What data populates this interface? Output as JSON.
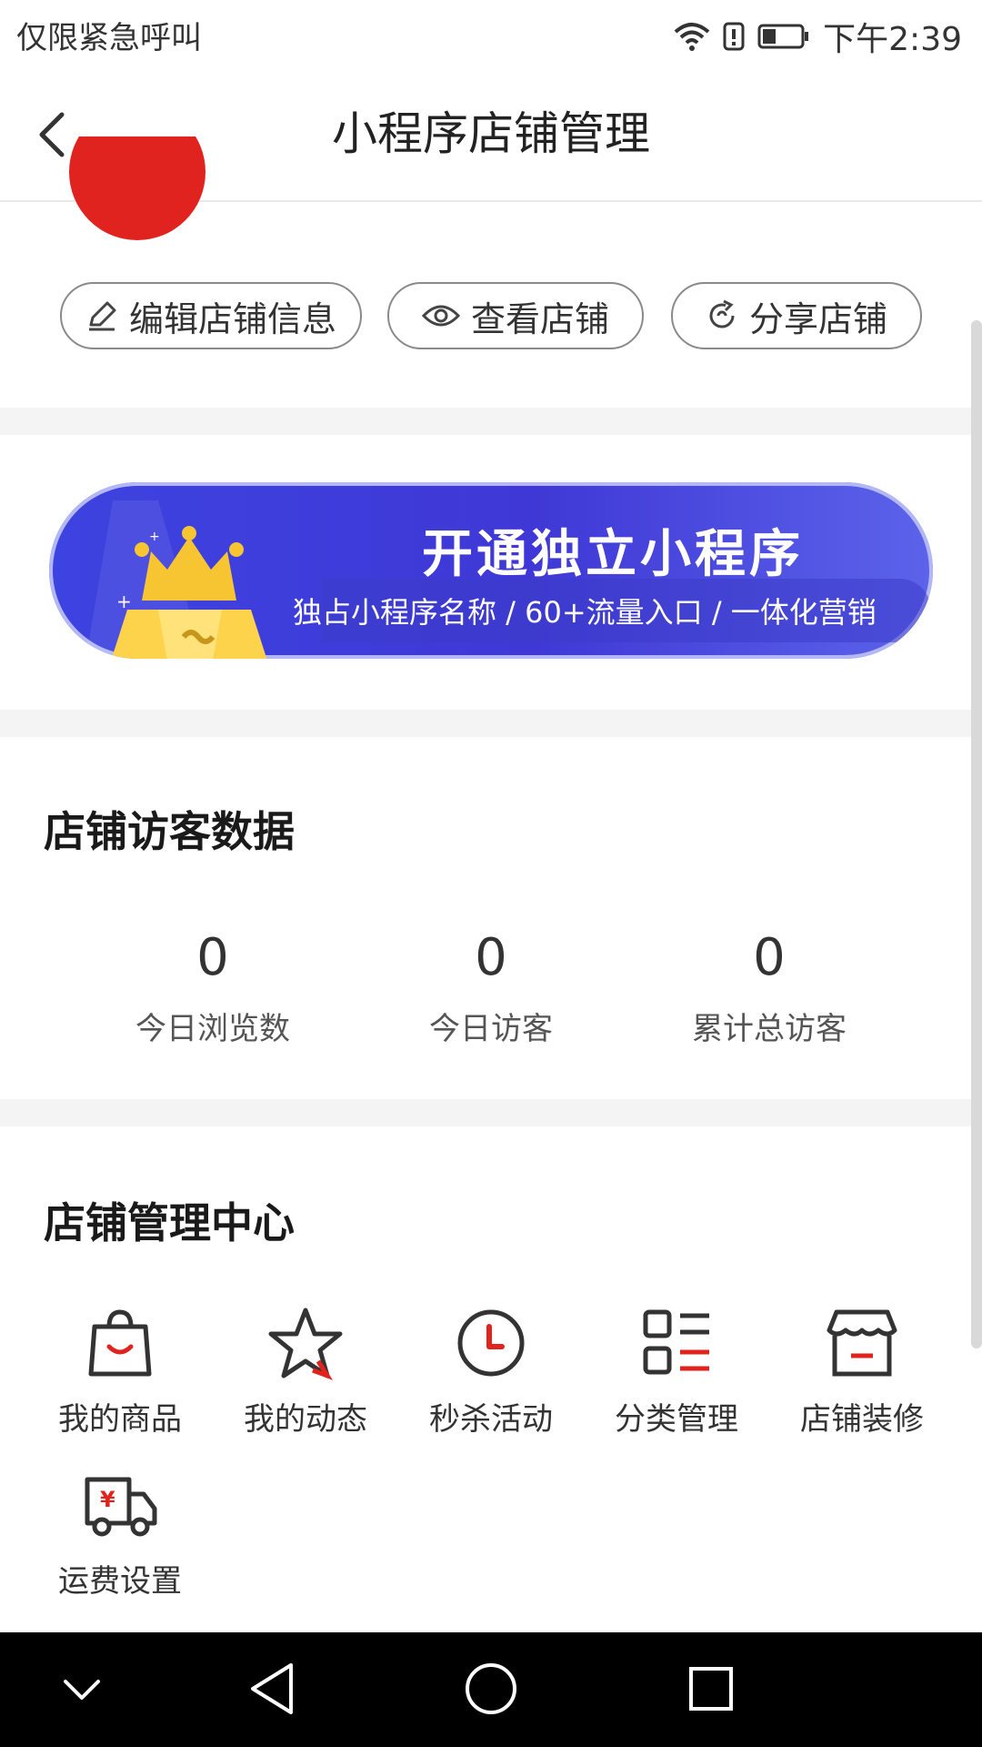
{
  "status_bar": {
    "carrier_text": "仅限紧急呼叫",
    "time": "下午2:39",
    "icons": [
      "wifi-icon",
      "alert-icon",
      "battery-icon"
    ]
  },
  "nav": {
    "title": "小程序店铺管理",
    "back_icon": "chevron-left-icon"
  },
  "actions": [
    {
      "label": "编辑店铺信息",
      "icon": "edit-icon"
    },
    {
      "label": "查看店铺",
      "icon": "eye-icon"
    },
    {
      "label": "分享店铺",
      "icon": "refresh-share-icon"
    }
  ],
  "banner": {
    "title": "开通独立小程序",
    "subtitle": "独占小程序名称 / 60+流量入口 / 一体化营销",
    "colors": {
      "bg": "#3f38d6",
      "crown": "#f7c531"
    }
  },
  "visitor_section": {
    "title": "店铺访客数据",
    "stats": [
      {
        "value": "0",
        "label": "今日浏览数"
      },
      {
        "value": "0",
        "label": "今日访客"
      },
      {
        "value": "0",
        "label": "累计总访客"
      }
    ]
  },
  "management_section": {
    "title": "店铺管理中心",
    "items": [
      {
        "label": "我的商品",
        "icon": "shopping-bag-icon"
      },
      {
        "label": "我的动态",
        "icon": "star-icon"
      },
      {
        "label": "秒杀活动",
        "icon": "clock-icon"
      },
      {
        "label": "分类管理",
        "icon": "category-list-icon"
      },
      {
        "label": "店铺装修",
        "icon": "storefront-icon"
      },
      {
        "label": "运费设置",
        "icon": "delivery-truck-icon"
      }
    ]
  },
  "colors": {
    "accent": "#e0231f",
    "divider": "#f4f4f4"
  }
}
